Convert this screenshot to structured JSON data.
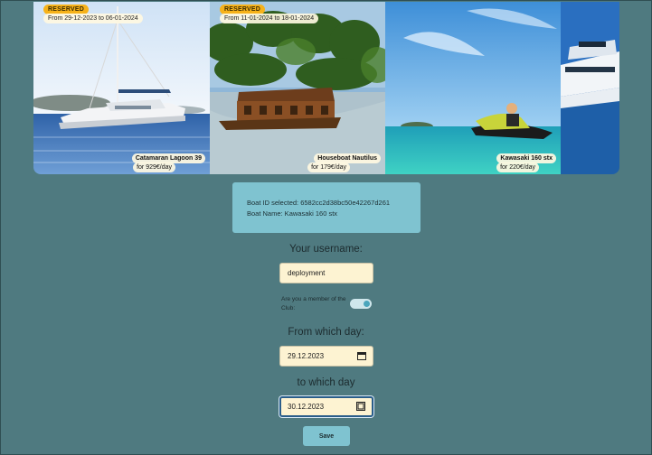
{
  "boats": [
    {
      "status": "RESERVED",
      "dates": "From 29-12-2023 to 06-01-2024",
      "name": "Catamaran Lagoon 39",
      "price": "for 929€/day"
    },
    {
      "status": "RESERVED",
      "dates": "From 11-01-2024 to 18-01-2024",
      "name": "Houseboat Nautilus",
      "price": "for 179€/day"
    },
    {
      "status": "",
      "dates": "",
      "name": "Kawasaki 160 stx",
      "price": "for 220€/day"
    },
    {
      "status": "",
      "dates": "",
      "name": "",
      "price": ""
    }
  ],
  "selection": {
    "id_line": "Boat ID selected: 6582cc2d38bc50e42267d261",
    "name_line": "Boat Name: Kawasaki 160 stx"
  },
  "form": {
    "username_label": "Your username:",
    "username_value": "deployment",
    "member_label": "Are you a member of the Club:",
    "member_checked": true,
    "from_label": "From which day:",
    "from_value": "29.12.2023",
    "to_label": "to which day",
    "to_value": "30.12.2023",
    "save_label": "Save"
  },
  "icons": {
    "calendar": "calendar-icon"
  },
  "colors": {
    "background": "#4f7a80",
    "accent": "#7fc3d0",
    "field": "#fdf3d2",
    "badge": "#f6b21a"
  }
}
